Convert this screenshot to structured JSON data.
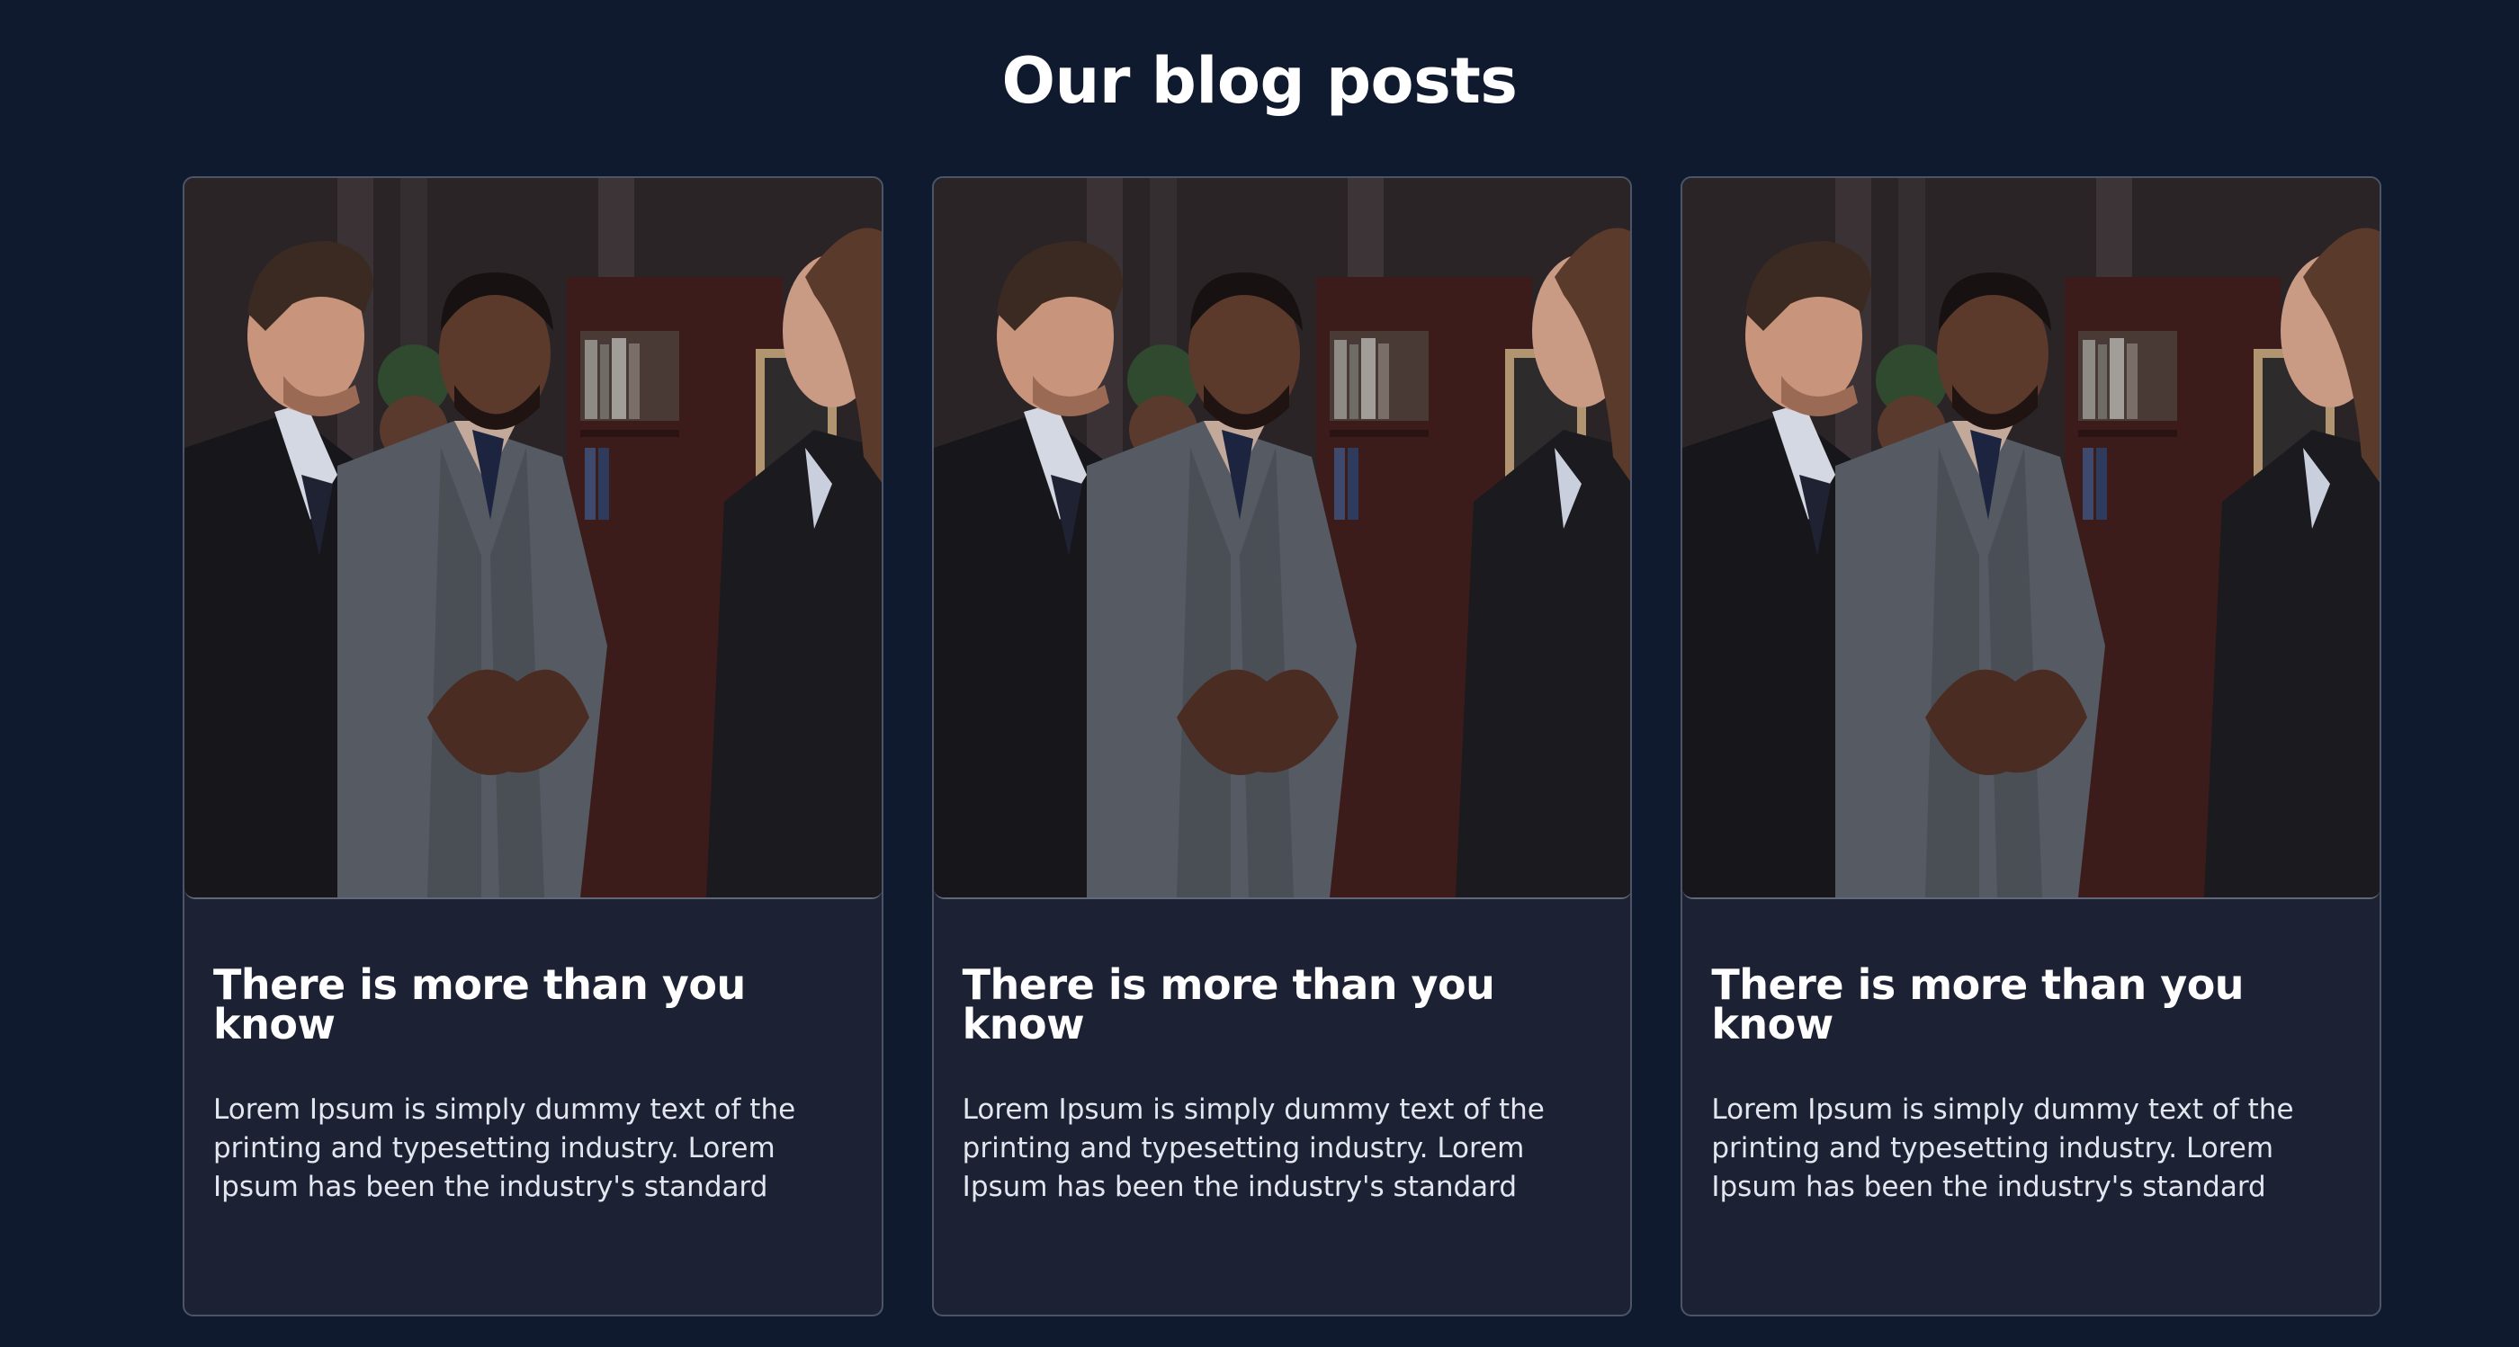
{
  "section": {
    "heading": "Our blog posts"
  },
  "posts": [
    {
      "title": "There is more than you know",
      "excerpt": "Lorem Ipsum is simply dummy text of the printing and typesetting industry. Lorem Ipsum has been the industry's standard",
      "image": "business-people-meeting-photo"
    },
    {
      "title": "There is more than you know",
      "excerpt": "Lorem Ipsum is simply dummy text of the printing and typesetting industry. Lorem Ipsum has been the industry's standard",
      "image": "business-people-meeting-photo"
    },
    {
      "title": "There is more than you know",
      "excerpt": "Lorem Ipsum is simply dummy text of the printing and typesetting industry. Lorem Ipsum has been the industry's standard",
      "image": "business-people-meeting-photo"
    }
  ],
  "colors": {
    "page_background": "#101a2f",
    "card_background": "#1d2134",
    "card_border": "#4c5568",
    "heading_text": "#ffffff",
    "body_text": "#e3e6ee"
  }
}
